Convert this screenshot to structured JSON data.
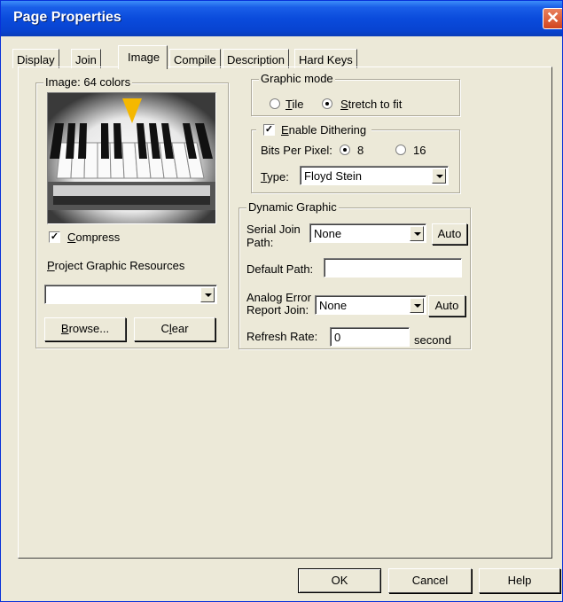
{
  "window": {
    "title": "Page Properties",
    "close_glyph": "✕"
  },
  "tabs": [
    {
      "label": "Display",
      "active": false
    },
    {
      "label": "Join",
      "active": false
    },
    {
      "label": "Image",
      "active": true
    },
    {
      "label": "Compile",
      "active": false
    },
    {
      "label": "Description",
      "active": false
    },
    {
      "label": "Hard Keys",
      "active": false
    }
  ],
  "image_group": {
    "label": "Image: 64 colors",
    "preview_icon": "piano-keys-image",
    "compress": {
      "label_first": "C",
      "label_rest": "ompress",
      "checked": true
    },
    "resources_label_first": "P",
    "resources_label_rest": "roject Graphic Resources",
    "resources_value": "",
    "browse": {
      "first": "B",
      "rest": "rowse..."
    },
    "clear": {
      "pre": "C",
      "ul": "l",
      "post": "ear"
    }
  },
  "graphic_mode": {
    "label": "Graphic mode",
    "tile": {
      "first": "T",
      "rest": "ile",
      "selected": false
    },
    "stretch": {
      "first": "S",
      "rest": "tretch to fit",
      "selected": true
    }
  },
  "dithering": {
    "label_first": "E",
    "label_rest": "nable Dithering",
    "checked": true,
    "bits_label": "Bits Per Pixel:",
    "bits_8": {
      "label": "8",
      "selected": true
    },
    "bits_16": {
      "label": "16",
      "selected": false
    },
    "type_label_first": "T",
    "type_label_rest": "ype:",
    "type_value": "Floyd Stein"
  },
  "dynamic_graphic": {
    "label": "Dynamic Graphic",
    "serial_label_1": "Serial Join",
    "serial_label_2": "Path:",
    "serial_value": "None",
    "serial_auto": "Auto",
    "default_path_label": "Default Path:",
    "default_path_value": "",
    "analog_label_1": "Analog Error",
    "analog_label_2": "Report Join:",
    "analog_value": "None",
    "analog_auto": "Auto",
    "refresh_label": "Refresh Rate:",
    "refresh_value": "0",
    "refresh_unit": "second"
  },
  "buttons": {
    "ok": "OK",
    "cancel": "Cancel",
    "help": "Help"
  },
  "colors": {
    "title_blue": "#0a4bdc",
    "dialog_bg": "#ece9d8",
    "pointer_yellow": "#f5b800"
  }
}
